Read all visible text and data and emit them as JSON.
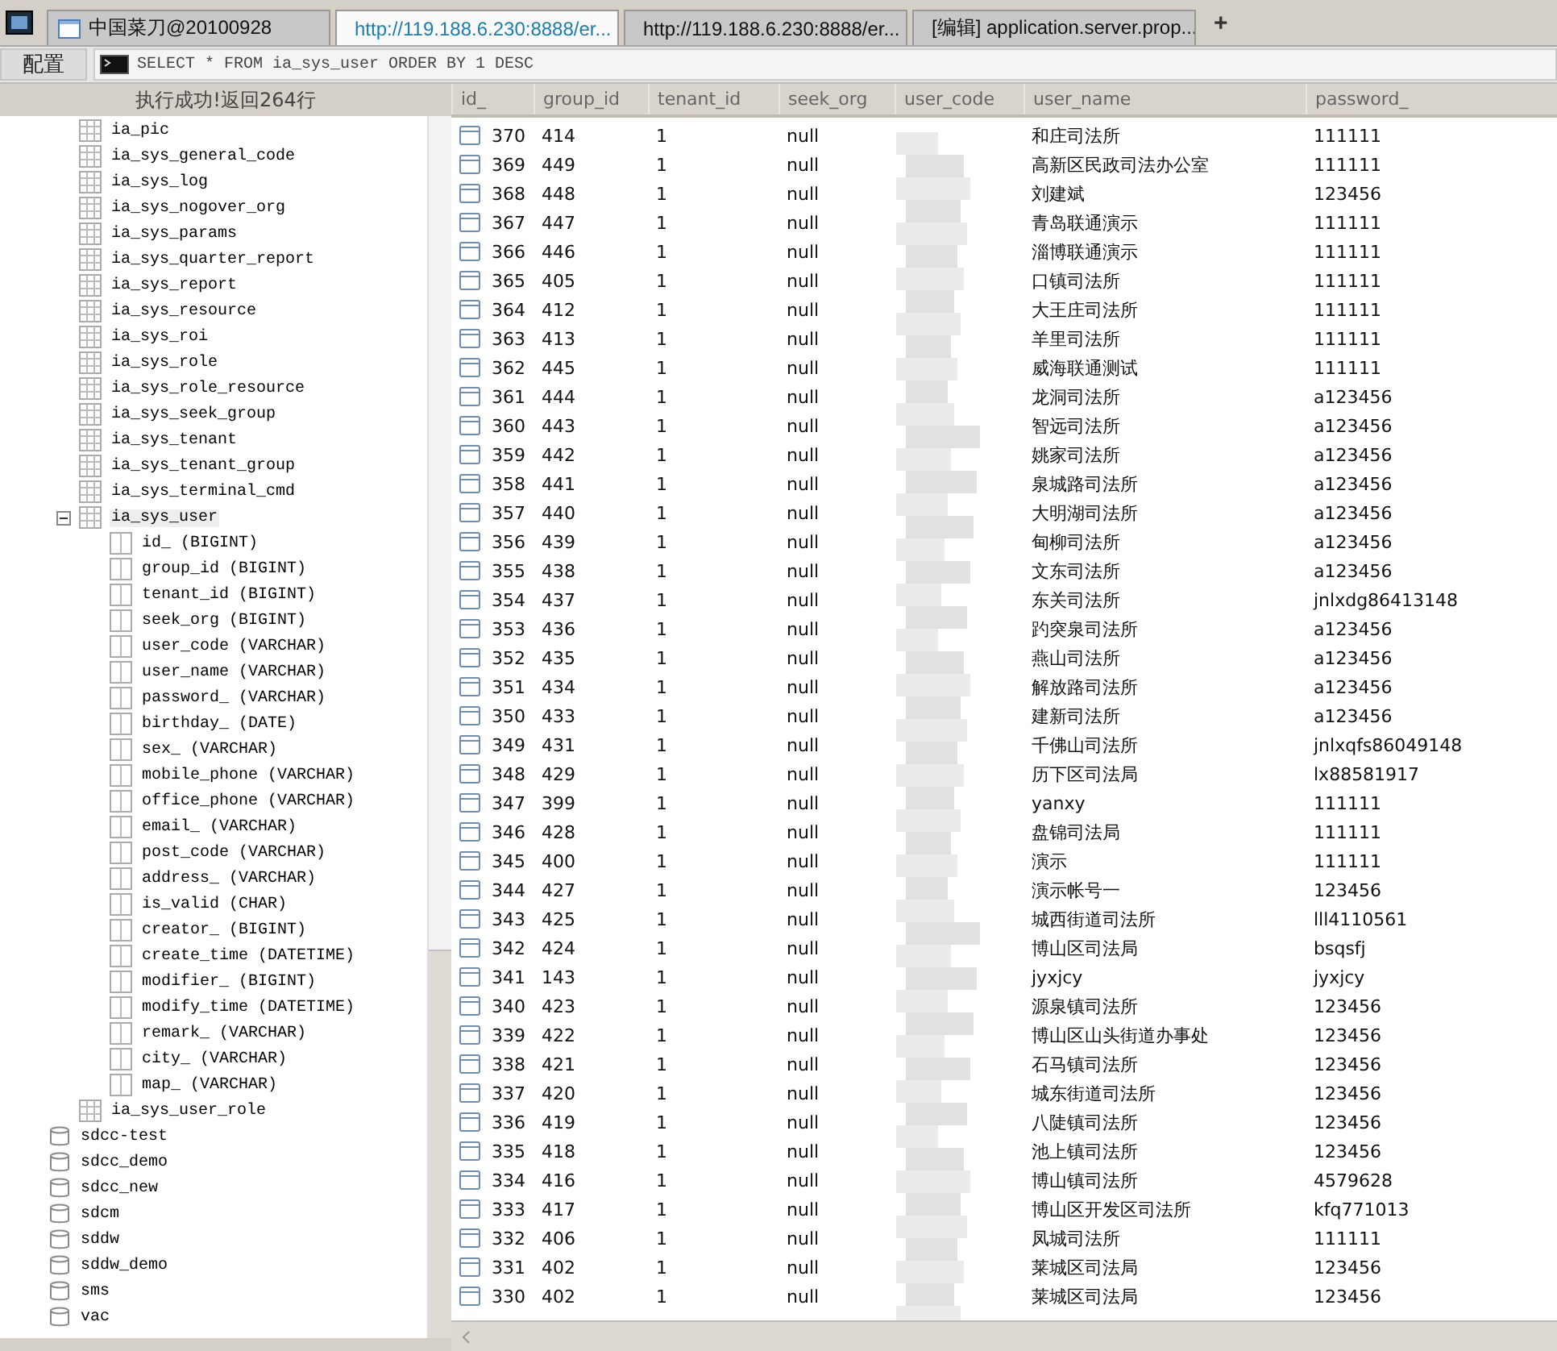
{
  "tabs": [
    {
      "kind": "app",
      "label": "中国菜刀@20100928",
      "selected": false
    },
    {
      "kind": "web",
      "label": "http://119.188.6.230:8888/er...",
      "selected": true
    },
    {
      "kind": "folder",
      "label": "http://119.188.6.230:8888/er...",
      "selected": false
    },
    {
      "kind": "doc",
      "label": "[编辑] application.server.prop...",
      "selected": false
    }
  ],
  "new_tab": "+",
  "toolbar": {
    "config_button": "配置",
    "sql": "SELECT * FROM ia_sys_user ORDER BY 1 DESC"
  },
  "result_status": "执行成功!返回264行",
  "tree": [
    {
      "children": [
        {
          "kind": "table",
          "label": "ia_pic"
        },
        {
          "kind": "table",
          "label": "ia_sys_general_code"
        },
        {
          "kind": "table",
          "label": "ia_sys_log"
        },
        {
          "kind": "table",
          "label": "ia_sys_nogover_org"
        },
        {
          "kind": "table",
          "label": "ia_sys_params"
        },
        {
          "kind": "table",
          "label": "ia_sys_quarter_report"
        },
        {
          "kind": "table",
          "label": "ia_sys_report"
        },
        {
          "kind": "table",
          "label": "ia_sys_resource"
        },
        {
          "kind": "table",
          "label": "ia_sys_roi"
        },
        {
          "kind": "table",
          "label": "ia_sys_role"
        },
        {
          "kind": "table",
          "label": "ia_sys_role_resource"
        },
        {
          "kind": "table",
          "label": "ia_sys_seek_group"
        },
        {
          "kind": "table",
          "label": "ia_sys_tenant"
        },
        {
          "kind": "table",
          "label": "ia_sys_tenant_group"
        },
        {
          "kind": "table",
          "label": "ia_sys_terminal_cmd"
        },
        {
          "kind": "table",
          "label": "ia_sys_user",
          "expanded": true,
          "selected": true,
          "children": [
            {
              "kind": "column",
              "label": "id_ (BIGINT)"
            },
            {
              "kind": "column",
              "label": "group_id (BIGINT)"
            },
            {
              "kind": "column",
              "label": "tenant_id (BIGINT)"
            },
            {
              "kind": "column",
              "label": "seek_org (BIGINT)"
            },
            {
              "kind": "column",
              "label": "user_code (VARCHAR)"
            },
            {
              "kind": "column",
              "label": "user_name (VARCHAR)"
            },
            {
              "kind": "column",
              "label": "password_ (VARCHAR)"
            },
            {
              "kind": "column",
              "label": "birthday_ (DATE)"
            },
            {
              "kind": "column",
              "label": "sex_ (VARCHAR)"
            },
            {
              "kind": "column",
              "label": "mobile_phone (VARCHAR)"
            },
            {
              "kind": "column",
              "label": "office_phone (VARCHAR)"
            },
            {
              "kind": "column",
              "label": "email_ (VARCHAR)"
            },
            {
              "kind": "column",
              "label": "post_code (VARCHAR)"
            },
            {
              "kind": "column",
              "label": "address_ (VARCHAR)"
            },
            {
              "kind": "column",
              "label": "is_valid (CHAR)"
            },
            {
              "kind": "column",
              "label": "creator_ (BIGINT)"
            },
            {
              "kind": "column",
              "label": "create_time (DATETIME)"
            },
            {
              "kind": "column",
              "label": "modifier_ (BIGINT)"
            },
            {
              "kind": "column",
              "label": "modify_time (DATETIME)"
            },
            {
              "kind": "column",
              "label": "remark_ (VARCHAR)"
            },
            {
              "kind": "column",
              "label": "city_ (VARCHAR)"
            },
            {
              "kind": "column",
              "label": "map_ (VARCHAR)"
            }
          ]
        },
        {
          "kind": "table",
          "label": "ia_sys_user_role"
        }
      ]
    },
    {
      "kind": "database",
      "label": "sdcc-test"
    },
    {
      "kind": "database",
      "label": "sdcc_demo"
    },
    {
      "kind": "database",
      "label": "sdcc_new"
    },
    {
      "kind": "database",
      "label": "sdcm"
    },
    {
      "kind": "database",
      "label": "sddw"
    },
    {
      "kind": "database",
      "label": "sddw_demo"
    },
    {
      "kind": "database",
      "label": "sms"
    },
    {
      "kind": "database",
      "label": "vac"
    }
  ],
  "table": {
    "columns": [
      "id_",
      "group_id",
      "tenant_id",
      "seek_org",
      "user_code",
      "user_name",
      "password_"
    ],
    "rows": [
      {
        "id_": "370",
        "group_id": "414",
        "tenant_id": "1",
        "seek_org": "null",
        "user_name": "和庄司法所",
        "password_": "111111"
      },
      {
        "id_": "369",
        "group_id": "449",
        "tenant_id": "1",
        "seek_org": "null",
        "user_name": "高新区民政司法办公室",
        "password_": "111111"
      },
      {
        "id_": "368",
        "group_id": "448",
        "tenant_id": "1",
        "seek_org": "null",
        "user_name": "刘建斌",
        "password_": "123456"
      },
      {
        "id_": "367",
        "group_id": "447",
        "tenant_id": "1",
        "seek_org": "null",
        "user_name": "青岛联通演示",
        "password_": "111111"
      },
      {
        "id_": "366",
        "group_id": "446",
        "tenant_id": "1",
        "seek_org": "null",
        "user_name": "淄博联通演示",
        "password_": "111111"
      },
      {
        "id_": "365",
        "group_id": "405",
        "tenant_id": "1",
        "seek_org": "null",
        "user_name": "口镇司法所",
        "password_": "111111"
      },
      {
        "id_": "364",
        "group_id": "412",
        "tenant_id": "1",
        "seek_org": "null",
        "user_name": "大王庄司法所",
        "password_": "111111"
      },
      {
        "id_": "363",
        "group_id": "413",
        "tenant_id": "1",
        "seek_org": "null",
        "user_name": "羊里司法所",
        "password_": "111111"
      },
      {
        "id_": "362",
        "group_id": "445",
        "tenant_id": "1",
        "seek_org": "null",
        "user_name": "威海联通测试",
        "password_": "111111"
      },
      {
        "id_": "361",
        "group_id": "444",
        "tenant_id": "1",
        "seek_org": "null",
        "user_name": "龙洞司法所",
        "password_": "a123456"
      },
      {
        "id_": "360",
        "group_id": "443",
        "tenant_id": "1",
        "seek_org": "null",
        "user_name": "智远司法所",
        "password_": "a123456"
      },
      {
        "id_": "359",
        "group_id": "442",
        "tenant_id": "1",
        "seek_org": "null",
        "user_name": "姚家司法所",
        "password_": "a123456"
      },
      {
        "id_": "358",
        "group_id": "441",
        "tenant_id": "1",
        "seek_org": "null",
        "user_name": "泉城路司法所",
        "password_": "a123456"
      },
      {
        "id_": "357",
        "group_id": "440",
        "tenant_id": "1",
        "seek_org": "null",
        "user_name": "大明湖司法所",
        "password_": "a123456"
      },
      {
        "id_": "356",
        "group_id": "439",
        "tenant_id": "1",
        "seek_org": "null",
        "user_name": "甸柳司法所",
        "password_": "a123456"
      },
      {
        "id_": "355",
        "group_id": "438",
        "tenant_id": "1",
        "seek_org": "null",
        "user_name": "文东司法所",
        "password_": "a123456"
      },
      {
        "id_": "354",
        "group_id": "437",
        "tenant_id": "1",
        "seek_org": "null",
        "user_name": "东关司法所",
        "password_": "jnlxdg86413148"
      },
      {
        "id_": "353",
        "group_id": "436",
        "tenant_id": "1",
        "seek_org": "null",
        "user_name": "趵突泉司法所",
        "password_": "a123456"
      },
      {
        "id_": "352",
        "group_id": "435",
        "tenant_id": "1",
        "seek_org": "null",
        "user_name": "燕山司法所",
        "password_": "a123456"
      },
      {
        "id_": "351",
        "group_id": "434",
        "tenant_id": "1",
        "seek_org": "null",
        "user_name": "解放路司法所",
        "password_": "a123456"
      },
      {
        "id_": "350",
        "group_id": "433",
        "tenant_id": "1",
        "seek_org": "null",
        "user_name": "建新司法所",
        "password_": "a123456"
      },
      {
        "id_": "349",
        "group_id": "431",
        "tenant_id": "1",
        "seek_org": "null",
        "user_name": "千佛山司法所",
        "password_": "jnlxqfs86049148"
      },
      {
        "id_": "348",
        "group_id": "429",
        "tenant_id": "1",
        "seek_org": "null",
        "user_name": "历下区司法局",
        "password_": "lx88581917"
      },
      {
        "id_": "347",
        "group_id": "399",
        "tenant_id": "1",
        "seek_org": "null",
        "user_name": "yanxy",
        "password_": "111111"
      },
      {
        "id_": "346",
        "group_id": "428",
        "tenant_id": "1",
        "seek_org": "null",
        "user_name": "盘锦司法局",
        "password_": "111111"
      },
      {
        "id_": "345",
        "group_id": "400",
        "tenant_id": "1",
        "seek_org": "null",
        "user_name": "演示",
        "password_": "111111"
      },
      {
        "id_": "344",
        "group_id": "427",
        "tenant_id": "1",
        "seek_org": "null",
        "user_name": "演示帐号一",
        "password_": "123456"
      },
      {
        "id_": "343",
        "group_id": "425",
        "tenant_id": "1",
        "seek_org": "null",
        "user_name": "城西街道司法所",
        "password_": "lll4110561"
      },
      {
        "id_": "342",
        "group_id": "424",
        "tenant_id": "1",
        "seek_org": "null",
        "user_name": "博山区司法局",
        "password_": "bsqsfj"
      },
      {
        "id_": "341",
        "group_id": "143",
        "tenant_id": "1",
        "seek_org": "null",
        "user_name": "jyxjcy",
        "password_": "jyxjcy"
      },
      {
        "id_": "340",
        "group_id": "423",
        "tenant_id": "1",
        "seek_org": "null",
        "user_name": "源泉镇司法所",
        "password_": "123456"
      },
      {
        "id_": "339",
        "group_id": "422",
        "tenant_id": "1",
        "seek_org": "null",
        "user_name": "博山区山头街道办事处",
        "password_": "123456"
      },
      {
        "id_": "338",
        "group_id": "421",
        "tenant_id": "1",
        "seek_org": "null",
        "user_name": "石马镇司法所",
        "password_": "123456"
      },
      {
        "id_": "337",
        "group_id": "420",
        "tenant_id": "1",
        "seek_org": "null",
        "user_name": "城东街道司法所",
        "password_": "123456"
      },
      {
        "id_": "336",
        "group_id": "419",
        "tenant_id": "1",
        "seek_org": "null",
        "user_name": "八陡镇司法所",
        "password_": "123456"
      },
      {
        "id_": "335",
        "group_id": "418",
        "tenant_id": "1",
        "seek_org": "null",
        "user_name": "池上镇司法所",
        "password_": "123456"
      },
      {
        "id_": "334",
        "group_id": "416",
        "tenant_id": "1",
        "seek_org": "null",
        "user_name": "博山镇司法所",
        "password_": "4579628"
      },
      {
        "id_": "333",
        "group_id": "417",
        "tenant_id": "1",
        "seek_org": "null",
        "user_name": "博山区开发区司法所",
        "password_": "kfq771013"
      },
      {
        "id_": "332",
        "group_id": "406",
        "tenant_id": "1",
        "seek_org": "null",
        "user_name": "凤城司法所",
        "password_": "111111"
      },
      {
        "id_": "331",
        "group_id": "402",
        "tenant_id": "1",
        "seek_org": "null",
        "user_name": "莱城区司法局",
        "password_": "123456"
      },
      {
        "id_": "330",
        "group_id": "402",
        "tenant_id": "1",
        "seek_org": "null",
        "user_name": "莱城区司法局",
        "password_": "123456"
      }
    ]
  }
}
